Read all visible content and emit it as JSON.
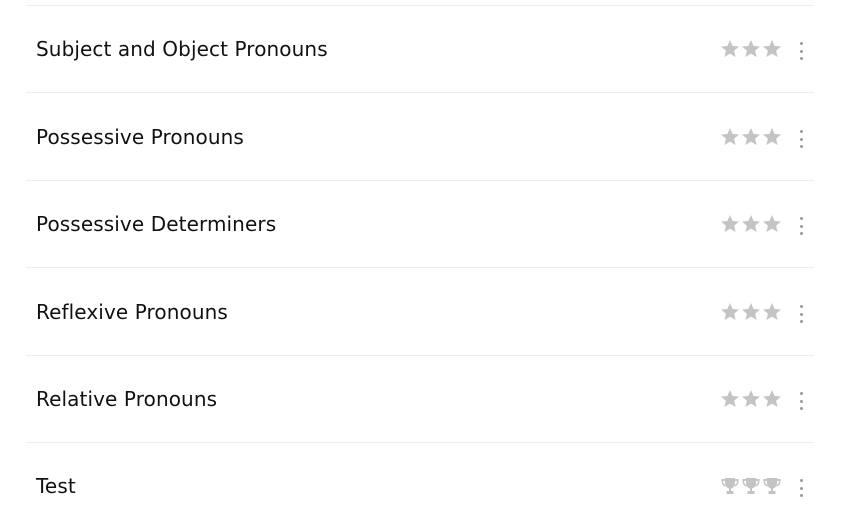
{
  "lessons": [
    {
      "title": "Subject and Object Pronouns",
      "rating_icon": "star-icon",
      "rating_count": 3,
      "menu_icon": "more-vertical-icon"
    },
    {
      "title": "Possessive Pronouns",
      "rating_icon": "star-icon",
      "rating_count": 3,
      "menu_icon": "more-vertical-icon"
    },
    {
      "title": "Possessive Determiners",
      "rating_icon": "star-icon",
      "rating_count": 3,
      "menu_icon": "more-vertical-icon"
    },
    {
      "title": "Reflexive Pronouns",
      "rating_icon": "star-icon",
      "rating_count": 3,
      "menu_icon": "more-vertical-icon"
    },
    {
      "title": "Relative Pronouns",
      "rating_icon": "star-icon",
      "rating_count": 3,
      "menu_icon": "more-vertical-icon"
    },
    {
      "title": "Test",
      "rating_icon": "trophy-icon",
      "rating_count": 3,
      "menu_icon": "more-vertical-icon"
    }
  ],
  "colors": {
    "icon_inactive": "#c4c4c4",
    "menu_dots": "#9a9a9a",
    "divider": "#eeeeee",
    "text": "#111111"
  }
}
